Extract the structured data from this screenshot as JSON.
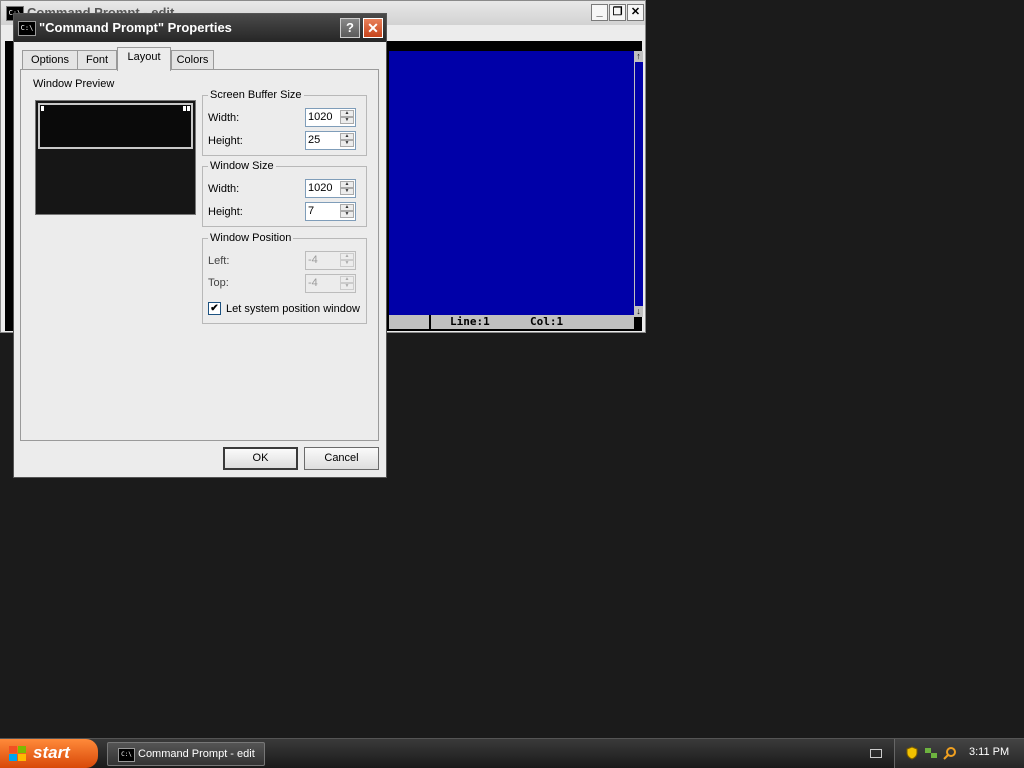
{
  "console_window": {
    "title": "Command Prompt - edit",
    "icon": "cmd-icon",
    "icon_text": "C:\\",
    "status_line": "Line:1",
    "status_col": "Col:1",
    "minimize": "_",
    "restore": "❐",
    "close": "✕",
    "scroll_up": "↑",
    "scroll_down": "↓"
  },
  "dialog": {
    "title": "\"Command Prompt\" Properties",
    "help": "?",
    "close": "✕",
    "tabs": [
      {
        "label": "Options",
        "active": false
      },
      {
        "label": "Font",
        "active": false
      },
      {
        "label": "Layout",
        "active": true
      },
      {
        "label": "Colors",
        "active": false
      }
    ],
    "window_preview_label": "Window Preview",
    "screen_buffer": {
      "legend": "Screen Buffer Size",
      "width_label": "Width:",
      "width_value": "1020",
      "height_label": "Height:",
      "height_value": "25"
    },
    "window_size": {
      "legend": "Window Size",
      "width_label": "Width:",
      "width_value": "1020",
      "height_label": "Height:",
      "height_value": "7"
    },
    "window_position": {
      "legend": "Window Position",
      "left_label": "Left:",
      "left_value": "-4",
      "top_label": "Top:",
      "top_value": "-4",
      "let_system_label": "Let system position window",
      "let_system_checked": true,
      "check_mark": "✔"
    },
    "ok_label": "OK",
    "cancel_label": "Cancel"
  },
  "taskbar": {
    "start_label": "start",
    "task_item": "Command Prompt - edit",
    "clock": "3:11 PM"
  },
  "colors": {
    "console_blue": "#0000a8",
    "start_orange": "#d84808",
    "close_red": "#c7431a"
  }
}
